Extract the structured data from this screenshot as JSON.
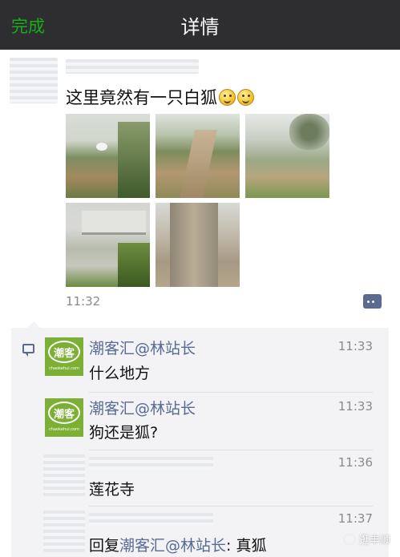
{
  "nav": {
    "done": "完成",
    "title": "详情"
  },
  "post": {
    "text": "这里竟然有一只白狐",
    "time": "11:32",
    "photos": [
      "photo-1",
      "photo-2",
      "photo-3",
      "photo-4",
      "photo-5"
    ]
  },
  "comments": [
    {
      "name": "潮客汇@林站长",
      "time": "11:33",
      "text": "什么地方",
      "avatar_text": "潮客",
      "avatar_sub": "chaokehui.com"
    },
    {
      "name": "潮客汇@林站长",
      "time": "11:33",
      "text": "狗还是狐?",
      "avatar_text": "潮客",
      "avatar_sub": "chaokehui.com"
    },
    {
      "time": "11:36",
      "text": "莲花寺"
    },
    {
      "time": "11:37",
      "reply_prefix": "回复",
      "reply_to": "潮客汇@林站长",
      "reply_sep": ": ",
      "text": "真狐"
    }
  ],
  "watermark": "逛丰顺",
  "colors": {
    "accent": "#1aad19",
    "link": "#576b95",
    "navbar": "#2e2e30"
  }
}
